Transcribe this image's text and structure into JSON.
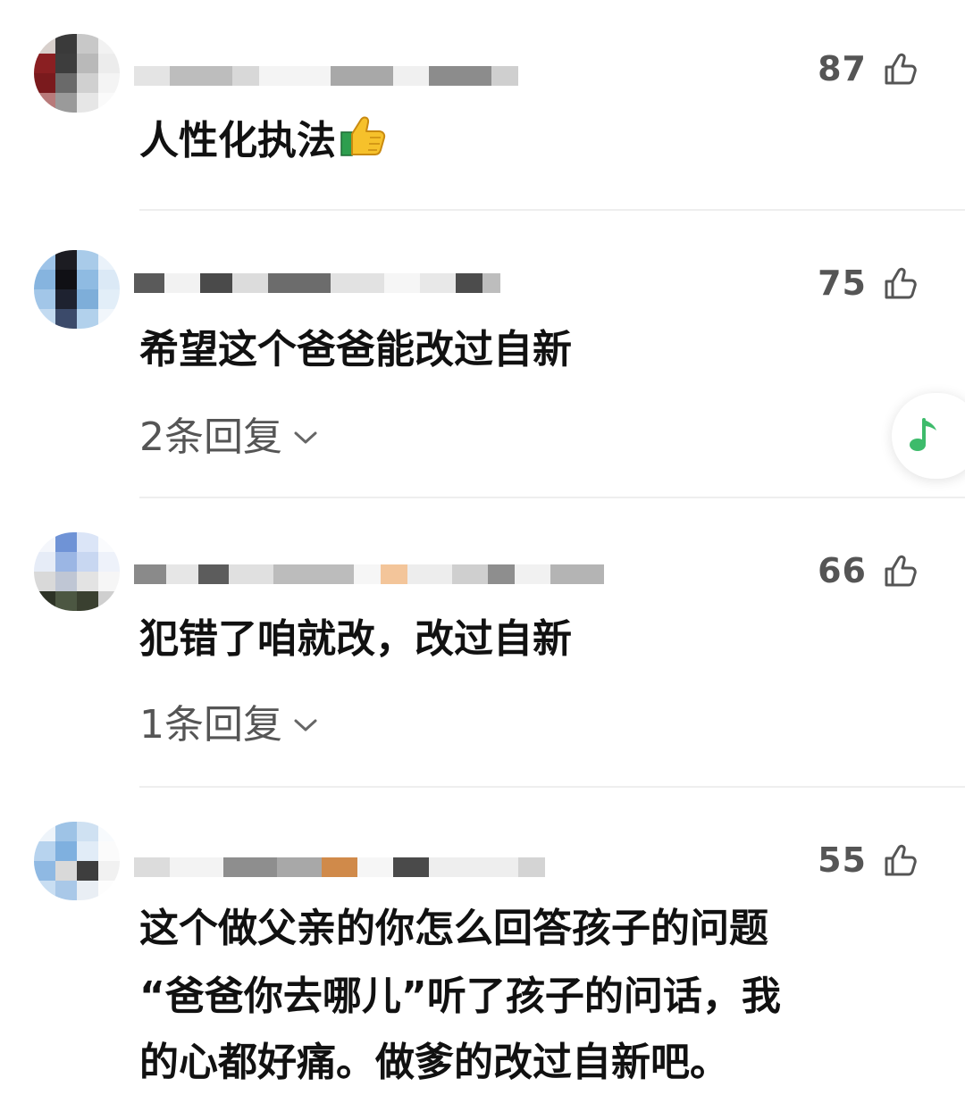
{
  "colors": {
    "text_primary": "#111111",
    "text_secondary": "#555555",
    "divider": "#eeeeee",
    "music_accent": "#3dbb6b"
  },
  "comments": [
    {
      "likes": "87",
      "text": "人性化执法",
      "emoji": "thumbs-up-emoji",
      "replies": ""
    },
    {
      "likes": "75",
      "text": "希望这个爸爸能改过自新",
      "replies": "2条回复"
    },
    {
      "likes": "66",
      "text": "犯错了咱就改，改过自新",
      "replies": "1条回复"
    },
    {
      "likes": "55",
      "text_lines": [
        "这个做父亲的你怎么回答孩子的问题",
        "“爸爸你去哪儿”听了孩子的问话，我",
        "的心都好痛。做爹的改过自新吧。"
      ]
    }
  ],
  "icons": {
    "like": "thumbs-up-outline-icon",
    "expand": "chevron-down-icon",
    "music": "music-note-icon"
  }
}
